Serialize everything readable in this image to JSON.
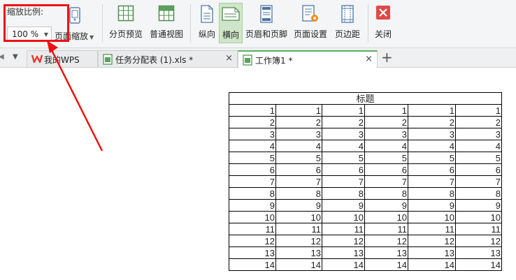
{
  "ribbon": {
    "zoom_caption": "缩放比例:",
    "zoom_value": "100 %",
    "page_zoom_label": "页面缩放",
    "buttons": [
      {
        "name": "page-break-preview-button",
        "label": "分页预览",
        "icon": "grid-icon"
      },
      {
        "name": "normal-view-button",
        "label": "普通视图",
        "icon": "grid-icon"
      },
      {
        "name": "portrait-button",
        "label": "纵向",
        "icon": "portrait-page-icon"
      },
      {
        "name": "landscape-button",
        "label": "横向",
        "icon": "landscape-page-icon"
      },
      {
        "name": "header-footer-button",
        "label": "页眉和页脚",
        "icon": "header-footer-icon"
      },
      {
        "name": "page-setup-button",
        "label": "页面设置",
        "icon": "page-setup-icon"
      },
      {
        "name": "margins-button",
        "label": "页边距",
        "icon": "margins-icon"
      },
      {
        "name": "close-button",
        "label": "关闭",
        "icon": "close-icon"
      }
    ]
  },
  "tabs": [
    {
      "label": "我的WPS",
      "icon": "wps-logo-icon",
      "close": "×"
    },
    {
      "label": "任务分配表 (1).xls *",
      "icon": "spreadsheet-icon",
      "close": "×"
    },
    {
      "label": "工作簿1 *",
      "icon": "spreadsheet-icon",
      "close": "×"
    }
  ],
  "new_tab_label": "+",
  "sheet": {
    "title": "标题",
    "rows": [
      [
        "1",
        "1",
        "1",
        "1",
        "1",
        "1"
      ],
      [
        "2",
        "2",
        "2",
        "2",
        "2",
        "2"
      ],
      [
        "3",
        "3",
        "3",
        "3",
        "3",
        "3"
      ],
      [
        "4",
        "4",
        "4",
        "4",
        "4",
        "4"
      ],
      [
        "5",
        "5",
        "5",
        "5",
        "5",
        "5"
      ],
      [
        "6",
        "6",
        "6",
        "6",
        "6",
        "6"
      ],
      [
        "7",
        "7",
        "7",
        "7",
        "7",
        "7"
      ],
      [
        "8",
        "8",
        "8",
        "8",
        "8",
        "8"
      ],
      [
        "9",
        "9",
        "9",
        "9",
        "9",
        "9"
      ],
      [
        "10",
        "10",
        "10",
        "10",
        "10",
        "10"
      ],
      [
        "11",
        "11",
        "11",
        "11",
        "11",
        "11"
      ],
      [
        "12",
        "12",
        "12",
        "12",
        "12",
        "12"
      ],
      [
        "13",
        "13",
        "13",
        "13",
        "13",
        "13"
      ],
      [
        "14",
        "14",
        "14",
        "14",
        "14",
        "14"
      ]
    ]
  },
  "colors": {
    "highlight": "#ee1111",
    "active_tab_accent": "#58b05c",
    "active_button_bg": "#cfe5c9",
    "close_red": "#e04848"
  }
}
